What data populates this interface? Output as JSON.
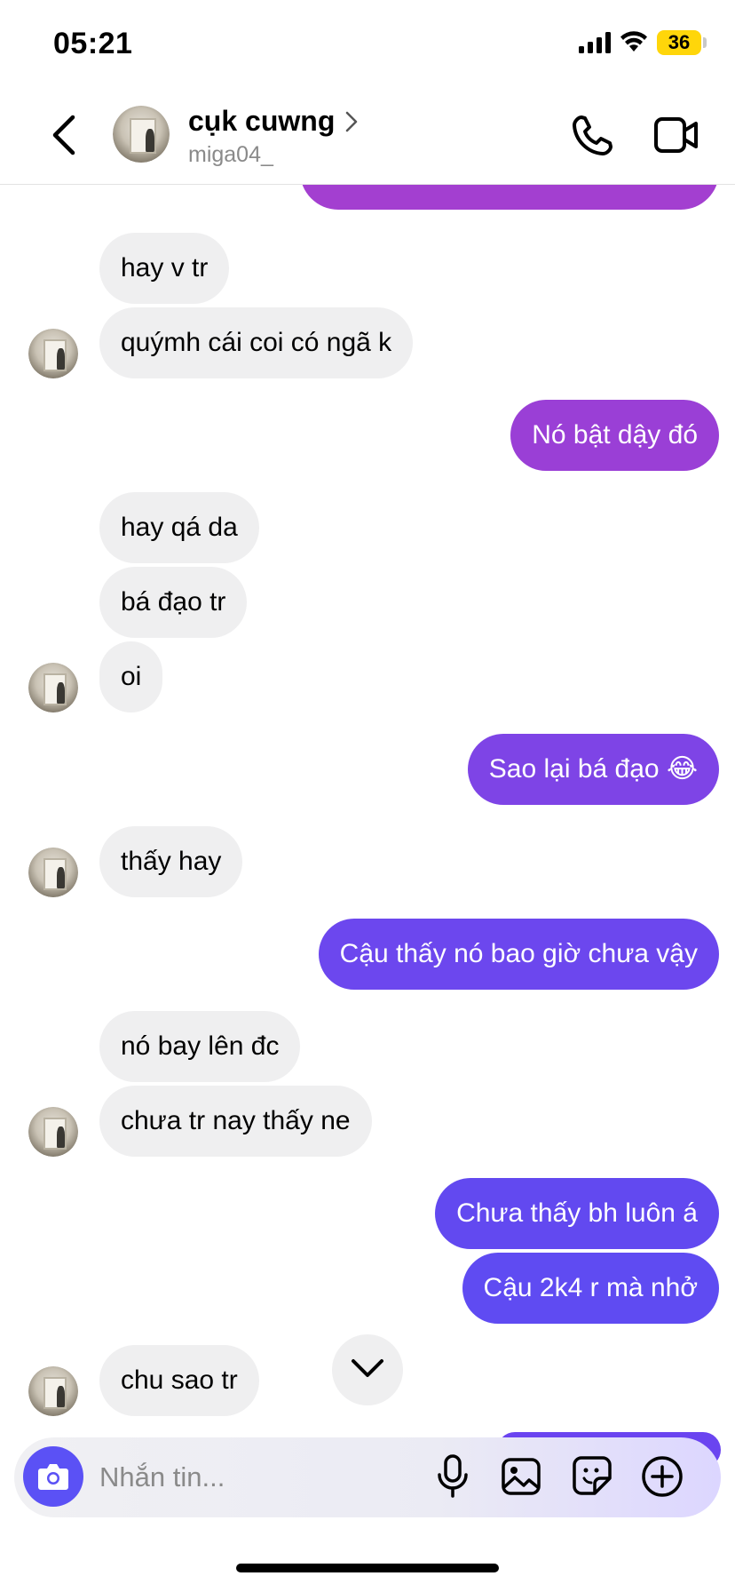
{
  "status_bar": {
    "time": "05:21",
    "battery": "36",
    "icons": [
      "signal-icon",
      "wifi-icon",
      "battery-icon"
    ]
  },
  "header": {
    "name": "cụk cuwng",
    "username": "miga04_",
    "icons": [
      "back-icon",
      "chevron-right-icon",
      "phone-icon",
      "video-camera-icon"
    ]
  },
  "messages": [
    {
      "side": "in",
      "text": "hay v tr"
    },
    {
      "side": "in",
      "text": "quýmh cái coi có ngã k"
    },
    {
      "side": "out",
      "text": "Nó bật dậy đó"
    },
    {
      "side": "in",
      "text": "hay qá da"
    },
    {
      "side": "in",
      "text": "bá đạo tr"
    },
    {
      "side": "in",
      "text": "oi"
    },
    {
      "side": "out",
      "text": "Sao lại bá đạo 😂"
    },
    {
      "side": "in",
      "text": "thấy hay"
    },
    {
      "side": "out",
      "text": "Cậu thấy nó bao giờ chưa vậy"
    },
    {
      "side": "in",
      "text": "nó bay lên đc"
    },
    {
      "side": "in",
      "text": "chưa tr nay thấy ne"
    },
    {
      "side": "out",
      "text": "Chưa thấy bh luôn á"
    },
    {
      "side": "out",
      "text": "Cậu 2k4 r mà nhở"
    },
    {
      "side": "in",
      "text": "chu sao tr"
    }
  ],
  "composer": {
    "placeholder": "Nhắn tin...",
    "icons": [
      "camera-icon",
      "microphone-icon",
      "gallery-icon",
      "sticker-icon",
      "plus-icon"
    ]
  },
  "colors": {
    "outgoing_gradient": [
      "#a33fd0",
      "#9a3fd6",
      "#7e44e6",
      "#6c47ee",
      "#5f4bf2"
    ],
    "incoming_bubble": "#efeff0",
    "camera_button": "#5b51f5"
  }
}
